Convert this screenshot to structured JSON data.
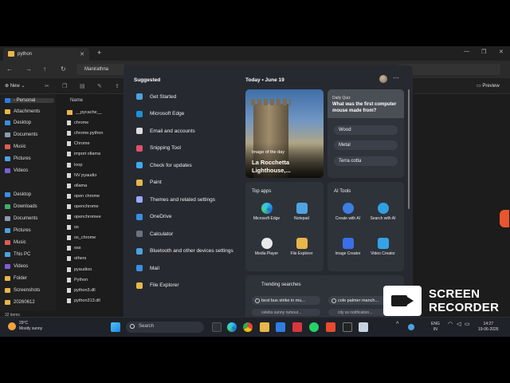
{
  "explorer": {
    "tab_title": "python",
    "path_segment": "Manirathna",
    "new_label": "New",
    "preview_label": "Preview",
    "sidebar": [
      {
        "label": "- Personal",
        "color": "#2f7de1",
        "selected": true
      },
      {
        "label": "Attachments",
        "color": "#e8b649"
      },
      {
        "label": "Desktop",
        "color": "#3a8ee6"
      },
      {
        "label": "Documents",
        "color": "#8a9bb0"
      },
      {
        "label": "Music",
        "color": "#e05a5a"
      },
      {
        "label": "Pictures",
        "color": "#4aa3df"
      },
      {
        "label": "Videos",
        "color": "#7b5fd6"
      },
      {
        "label": "Desktop",
        "color": "#3a8ee6"
      },
      {
        "label": "Downloads",
        "color": "#3fae6a"
      },
      {
        "label": "Documents",
        "color": "#8a9bb0"
      },
      {
        "label": "Pictures",
        "color": "#4aa3df"
      },
      {
        "label": "Music",
        "color": "#e05a5a"
      },
      {
        "label": "This PC",
        "color": "#4aa3df"
      },
      {
        "label": "Videos",
        "color": "#7b5fd6"
      },
      {
        "label": "Folder",
        "color": "#e8b649"
      },
      {
        "label": "Screenshots",
        "color": "#e8b649"
      },
      {
        "label": "20260612",
        "color": "#e8b649"
      }
    ],
    "column_name": "Name",
    "files": [
      {
        "name": "__pycache__",
        "folder": true
      },
      {
        "name": "chrome"
      },
      {
        "name": "chrome.python"
      },
      {
        "name": "Chrome"
      },
      {
        "name": "import ollama"
      },
      {
        "name": "loop"
      },
      {
        "name": "NV pyaudio"
      },
      {
        "name": "ollama"
      },
      {
        "name": "open chrome"
      },
      {
        "name": "openchrome"
      },
      {
        "name": "openchromee"
      },
      {
        "name": "os"
      },
      {
        "name": "os_chrome"
      },
      {
        "name": "oss"
      },
      {
        "name": "others"
      },
      {
        "name": "pyaudioo"
      },
      {
        "name": "Python"
      },
      {
        "name": "python3.dll"
      },
      {
        "name": "python313.dll"
      }
    ],
    "status": "32 items"
  },
  "start_menu": {
    "suggested_title": "Suggested",
    "suggested": [
      {
        "label": "Get Started",
        "icon": "get-started-icon"
      },
      {
        "label": "Microsoft Edge",
        "icon": "edge-icon"
      },
      {
        "label": "Email and accounts",
        "icon": "mail-icon"
      },
      {
        "label": "Snipping Tool",
        "icon": "snipping-tool-icon"
      },
      {
        "label": "Check for updates",
        "icon": "update-icon"
      },
      {
        "label": "Paint",
        "icon": "paint-icon"
      },
      {
        "label": "Themes and related settings",
        "icon": "themes-icon"
      },
      {
        "label": "OneDrive",
        "icon": "onedrive-icon"
      },
      {
        "label": "Calculator",
        "icon": "calculator-icon"
      },
      {
        "label": "Bluetooth and other devices settings",
        "icon": "bluetooth-icon"
      },
      {
        "label": "Mail",
        "icon": "mail-icon"
      },
      {
        "label": "File Explorer",
        "icon": "folder-icon"
      }
    ],
    "feed": {
      "today_label": "Today • June 19",
      "image_card": {
        "kicker": "Image of the day",
        "title": "La Rocchetta Lighthouse,..."
      },
      "quiz": {
        "kicker": "Daily Quiz",
        "question": "What was the first computer mouse made from?",
        "options": [
          "Wood",
          "Metal",
          "Terra cotta"
        ]
      },
      "top_apps_title": "Top apps",
      "top_apps": [
        {
          "label": "Microsoft Edge",
          "color": "#1f8fd6"
        },
        {
          "label": "Notepad",
          "color": "#4fa3e0"
        },
        {
          "label": "Media Player",
          "color": "#e9e9e9"
        },
        {
          "label": "File Explorer",
          "color": "#e8b649"
        }
      ],
      "ai_tools_title": "AI Tools",
      "ai_tools": [
        {
          "label": "Create with AI",
          "color": "#3c7fe0"
        },
        {
          "label": "Search with AI",
          "color": "#2fa0e0"
        },
        {
          "label": "Image Creator",
          "color": "#3a6fe8"
        },
        {
          "label": "Video Creator",
          "color": "#35a2e8"
        }
      ],
      "trending_title": "Trending searches",
      "trending": [
        "best bus strike in mu...",
        "cole palmer manch..."
      ],
      "trending_partial": [
        "celebs sunny rumour...",
        "city ss notification..."
      ]
    }
  },
  "taskbar": {
    "weather_temp": "29°C",
    "weather_desc": "Mostly sunny",
    "search_placeholder": "Search",
    "lang_top": "ENG",
    "lang_bottom": "IN",
    "time": "14:27",
    "date": "19-06-2026"
  },
  "watermark": {
    "line1": "SCREEN",
    "line2": "RECORDER"
  }
}
